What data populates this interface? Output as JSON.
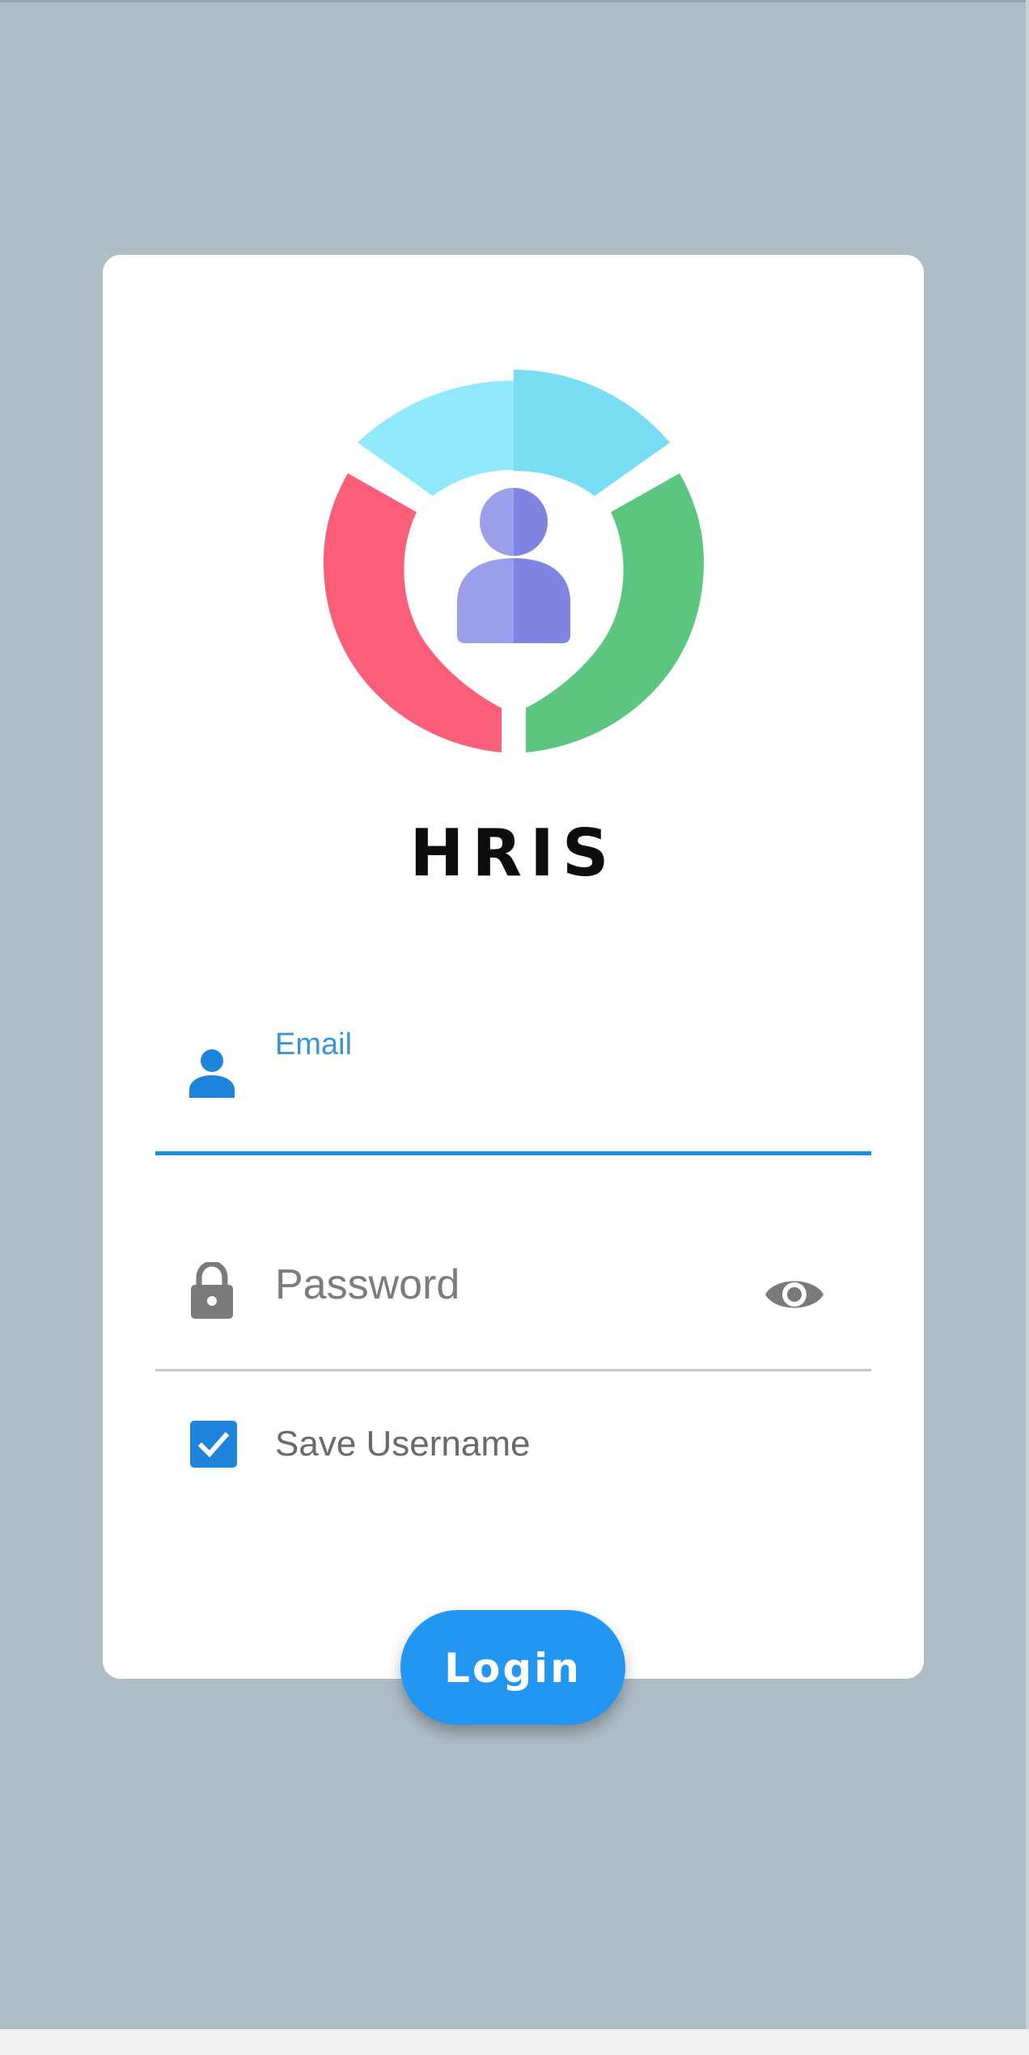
{
  "app": {
    "title": "HRIS"
  },
  "form": {
    "email": {
      "label": "Email",
      "value": "",
      "icon": "person-icon"
    },
    "password": {
      "placeholder": "Password",
      "value": "",
      "icon": "lock-icon",
      "toggle_icon": "eye-icon"
    },
    "save_username": {
      "label": "Save Username",
      "checked": true
    },
    "login_label": "Login"
  },
  "colors": {
    "background": "#afbdc5",
    "card": "#ffffff",
    "accent": "#2196f3",
    "email_label": "#3a95d6",
    "checkbox": "#1f85dc",
    "logo_top": "#8fe9fb",
    "logo_left": "#fb5e78",
    "logo_right": "#5cc680",
    "logo_person": "#8a8fe6"
  }
}
